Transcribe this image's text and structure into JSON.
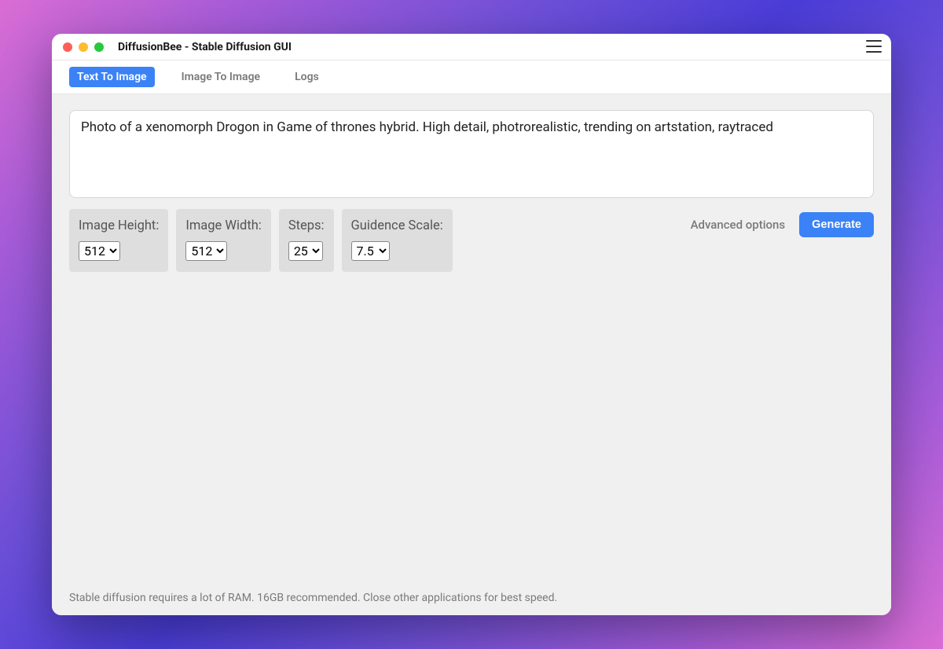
{
  "window": {
    "title": "DiffusionBee - Stable Diffusion GUI"
  },
  "tabs": {
    "items": [
      {
        "label": "Text To Image",
        "active": true
      },
      {
        "label": "Image To Image",
        "active": false
      },
      {
        "label": "Logs",
        "active": false
      }
    ]
  },
  "prompt": {
    "value": "Photo of a xenomorph Drogon in Game of thrones hybrid. High detail, photrorealistic, trending on artstation, raytraced"
  },
  "options": {
    "height": {
      "label": "Image Height:",
      "value": "512"
    },
    "width": {
      "label": "Image Width:",
      "value": "512"
    },
    "steps": {
      "label": "Steps:",
      "value": "25"
    },
    "scale": {
      "label": "Guidence Scale:",
      "value": "7.5"
    }
  },
  "actions": {
    "advanced_label": "Advanced options",
    "generate_label": "Generate"
  },
  "footer": {
    "note": "Stable diffusion requires a lot of RAM. 16GB recommended. Close other applications for best speed."
  }
}
